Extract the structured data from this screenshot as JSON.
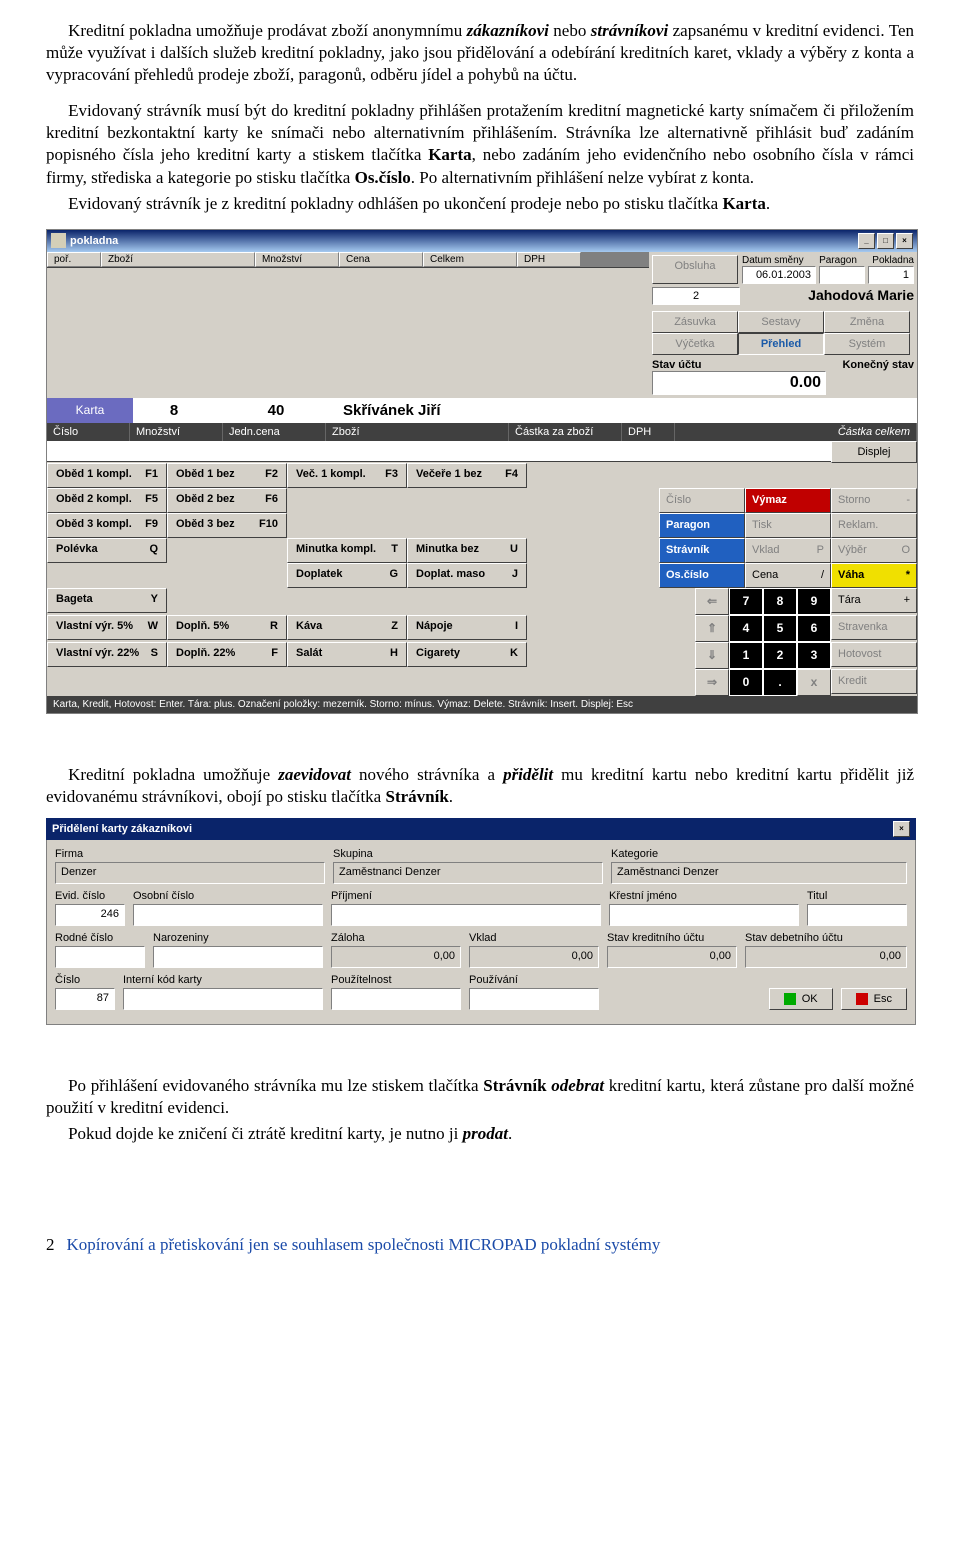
{
  "para1_a": "Kreditní pokladna umožňuje prodávat zboží anonymnímu ",
  "para1_b": "zákazníkovi",
  "para1_c": " nebo ",
  "para1_d": "strávníkovi",
  "para1_e": " zapsanému v kreditní evidenci. Ten může využívat i dalších služeb kreditní pokladny, jako jsou přidělování a odebírání kreditních karet, vklady a výběry z konta a vypracování přehledů prodeje zboží, paragonů, odběru jídel a pohybů na účtu.",
  "para2_a": "Evidovaný strávník musí být do kreditní pokladny přihlášen protažením kreditní magnetické karty snímačem či přiložením kreditní bezkontaktní karty ke snímači nebo alternativním přihlášením. Strávníka lze alternativně přihlásit buď zadáním popisného čísla jeho kreditní karty a stiskem tlačítka ",
  "para2_b": "Karta",
  "para2_c": ", nebo zadáním jeho evidenčního nebo osobního čísla v rámci firmy, střediska a kategorie po stisku tlačítka ",
  "para2_d": "Os.číslo",
  "para2_e": ". Po alternativním přihlášení nelze vybírat z konta.",
  "para3_a": "Evidovaný strávník je z kreditní pokladny odhlášen po ukončení prodeje nebo po stisku tlačítka ",
  "para3_b": "Karta",
  "para3_c": ".",
  "app": {
    "title": "pokladna",
    "min": "_",
    "max": "□",
    "close": "×",
    "cols": {
      "por": "poř.",
      "zbozi": "Zboží",
      "mnozstvi": "Množství",
      "cena": "Cena",
      "celkem": "Celkem",
      "dph": "DPH"
    },
    "right": {
      "datum_l": "Datum směny",
      "datum": "06.01.2003",
      "paragon_l": "Paragon",
      "paragon": "",
      "pokladna_l": "Pokladna",
      "pokladna": "1",
      "obsluha": "Obsluha",
      "poradove": "2",
      "name": "Jahodová Marie",
      "btn_zasuvka": "Zásuvka",
      "btn_sestavy": "Sestavy",
      "btn_zmena": "Změna",
      "btn_vycetka": "Výčetka",
      "btn_prehled": "Přehled",
      "btn_system": "Systém",
      "stav_l": "Stav účtu",
      "konec_l": "Konečný stav",
      "stav": "0.00"
    },
    "mid": {
      "karta": "Karta",
      "v1": "8",
      "v2": "40",
      "name": "Skřívánek Jiří",
      "h_cislo": "Číslo",
      "h_mnoz": "Množství",
      "h_jedn": "Jedn.cena",
      "h_zbozi": "Zboží",
      "h_czb": "Částka za zboží",
      "h_dph": "DPH",
      "h_cc": "Částka celkem",
      "displej": "Displej"
    },
    "f": {
      "o1": "Oběd 1 kompl.",
      "o1k": "F1",
      "o1b": "Oběd 1 bez",
      "o1bk": "F2",
      "v1": "Več. 1 kompl.",
      "v1k": "F3",
      "v1b": "Večeře 1 bez",
      "v1bk": "F4",
      "o2": "Oběd 2 kompl.",
      "o2k": "F5",
      "o2b": "Oběd 2 bez",
      "o2bk": "F6",
      "o3": "Oběd 3 kompl.",
      "o3k": "F9",
      "o3b": "Oběd 3 bez",
      "o3bk": "F10",
      "polevka": "Polévka",
      "polevkak": "Q",
      "minutka": "Minutka kompl.",
      "minutkak": "T",
      "minutkab": "Minutka bez",
      "minutkabk": "U",
      "doplatek": "Doplatek",
      "doplatekk": "G",
      "doplatm": "Doplat. maso",
      "dopatmk": "J",
      "bageta": "Bageta",
      "bagetak": "Y",
      "vv5": "Vlastní výr. 5%",
      "vv5k": "W",
      "dopl5": "Doplň. 5%",
      "dopl5k": "R",
      "kava": "Káva",
      "kavak": "Z",
      "napoje": "Nápoje",
      "napojek": "I",
      "vv22": "Vlastní výr. 22%",
      "vv22k": "S",
      "dopl22": "Doplň. 22%",
      "dopl22k": "F",
      "salat": "Salát",
      "salatk": "H",
      "cigarety": "Cigarety",
      "cigaretyk": "K"
    },
    "act": {
      "cislo": "Číslo",
      "vymaz": "Výmaz",
      "storno": "Storno",
      "stornok": "-",
      "paragon": "Paragon",
      "tisk": "Tisk",
      "reklam": "Reklam.",
      "stravnik": "Strávník",
      "vklad": "Vklad",
      "vkladk": "P",
      "vyber": "Výběr",
      "vyberk": "O",
      "oscislo": "Os.číslo",
      "cena": "Cena",
      "cenak": "/",
      "vaha": "Váha",
      "vahak": "*",
      "tara": "Tára",
      "tarak": "+",
      "stravenka": "Stravenka",
      "hotovost": "Hotovost",
      "kredit": "Kredit",
      "left": "⇐",
      "up": "⇑",
      "down": "⇓",
      "right": "⇒",
      "dot": ".",
      "x": "x"
    },
    "k": {
      "7": "7",
      "8": "8",
      "9": "9",
      "4": "4",
      "5": "5",
      "6": "6",
      "1": "1",
      "2": "2",
      "3": "3",
      "0": "0"
    },
    "status": "Karta, Kredit, Hotovost: Enter.   Tára: plus.   Označení položky: mezerník.   Storno: mínus.   Výmaz: Delete.   Strávník: Insert.   Displej: Esc"
  },
  "para4_a": "Kreditní pokladna umožňuje ",
  "para4_b": "zaevidovat",
  "para4_c": " nového strávníka a ",
  "para4_d": "přidělit",
  "para4_e": " mu kreditní kartu nebo kreditní kartu přidělit již evidovanému strávníkovi, obojí po stisku tlačítka ",
  "para4_f": "Strávník",
  "para4_g": ".",
  "dlg": {
    "title": "Přidělení karty zákazníkovi",
    "close": "×",
    "firma_l": "Firma",
    "firma": "Denzer",
    "skupina_l": "Skupina",
    "skupina": "Zaměstnanci Denzer",
    "kategorie_l": "Kategorie",
    "kategorie": "Zaměstnanci Denzer",
    "evid_l": "Evid. číslo",
    "evid": "246",
    "osob_l": "Osobní číslo",
    "osob": "",
    "prijmeni_l": "Příjmení",
    "prijmeni": "",
    "krestni_l": "Křestní jméno",
    "krestni": "",
    "titul_l": "Titul",
    "titul": "",
    "rodne_l": "Rodné číslo",
    "rodne": "",
    "naroz_l": "Narozeniny",
    "naroz": "",
    "zaloha_l": "Záloha",
    "zaloha": "0,00",
    "vklad_l": "Vklad",
    "vklad": "0,00",
    "stavk_l": "Stav kreditního účtu",
    "stavk": "0,00",
    "stavd_l": "Stav debetního účtu",
    "stavd": "0,00",
    "cislo_l": "Číslo",
    "cislo": "87",
    "intern_l": "Interní kód karty",
    "intern": "",
    "pouzitelnost_l": "Použítelnost",
    "pouzitelnost": "",
    "pouzivani_l": "Používání",
    "pouzivani": "",
    "ok": "OK",
    "esc": "Esc"
  },
  "para5_a": "Po přihlášení evidovaného strávníka mu lze stiskem tlačítka ",
  "para5_b": "Strávník",
  "para5_c": " ",
  "para5_d": "odebrat",
  "para5_e": " kreditní kartu, která zůstane pro další možné použití v kreditní evidenci.",
  "para6_a": "Pokud dojde ke zničení či ztrátě kreditní karty, je nutno ji ",
  "para6_b": "prodat",
  "para6_c": ".",
  "footer": {
    "num": "2",
    "txt": "Kopírování a přetiskování jen se souhlasem společnosti MICROPAD pokladní systémy"
  }
}
